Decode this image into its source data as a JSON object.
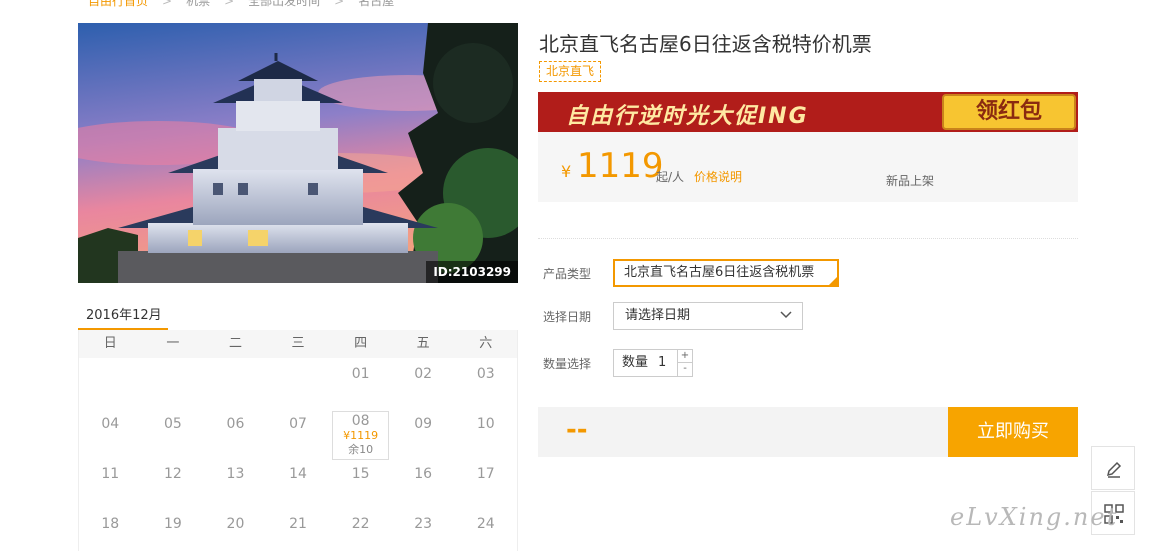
{
  "breadcrumb": {
    "items": [
      "自由行首页",
      "机票",
      "全部出发时间",
      "名古屋"
    ]
  },
  "product": {
    "image_id": "ID:2103299",
    "title": "北京直飞名古屋6日往返含税特价机票",
    "tag": "北京直飞"
  },
  "banner": {
    "text": "自由行逆时光大促ING",
    "button": "领红包"
  },
  "price": {
    "currency": "¥",
    "amount": "1119",
    "unit": "起/人",
    "explain_link": "价格说明",
    "new_badge": "新品上架"
  },
  "form": {
    "product_type_label": "产品类型",
    "product_type_value": "北京直飞名古屋6日往返含税机票",
    "date_label": "选择日期",
    "date_placeholder": "请选择日期",
    "qty_label": "数量选择",
    "qty_prefix": "数量",
    "qty_value": "1",
    "qty_plus": "+",
    "qty_minus": "-"
  },
  "buy": {
    "total": "--",
    "button": "立即购买"
  },
  "calendar": {
    "month": "2016年12月",
    "weekdays": [
      "日",
      "一",
      "二",
      "三",
      "四",
      "五",
      "六"
    ],
    "rows": [
      [
        "",
        "",
        "",
        "",
        "01",
        "02",
        "03"
      ],
      [
        "04",
        "05",
        "06",
        "07",
        "08",
        "09",
        "10"
      ],
      [
        "11",
        "12",
        "13",
        "14",
        "15",
        "16",
        "17"
      ],
      [
        "18",
        "19",
        "20",
        "21",
        "22",
        "23",
        "24"
      ]
    ],
    "available": {
      "day": "08",
      "price": "¥1119",
      "stock": "余10"
    }
  },
  "watermark": "eLvXing.net",
  "colors": {
    "accent": "#f39800",
    "banner_red": "#b11d1a",
    "buy_button": "#f7a400"
  }
}
